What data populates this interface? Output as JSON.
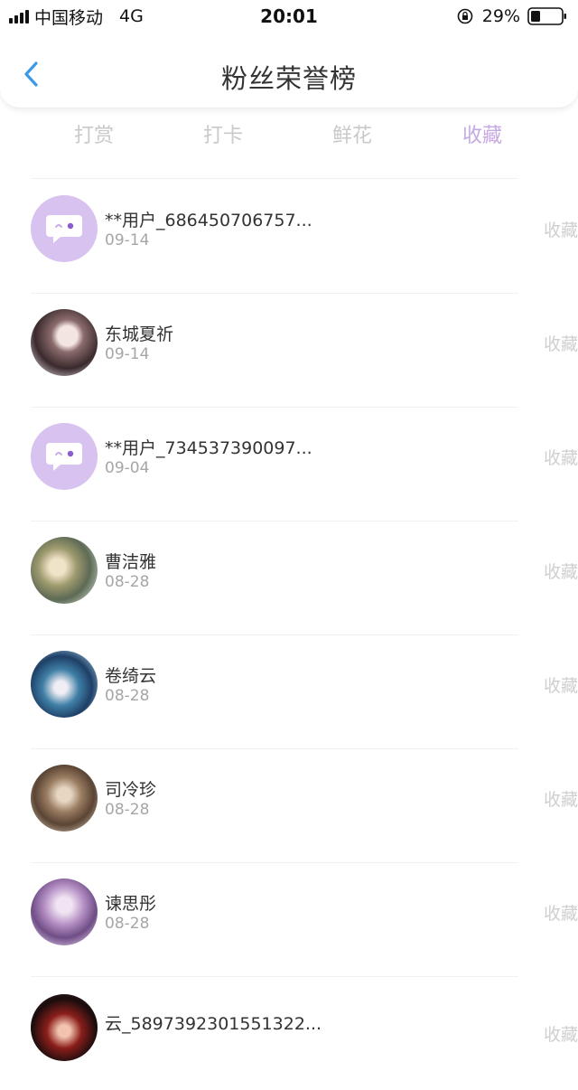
{
  "status_bar": {
    "carrier": "中国移动",
    "network": "4G",
    "time": "20:01",
    "battery": "29%"
  },
  "nav": {
    "title": "粉丝荣誉榜",
    "back_icon": "chevron-left-icon",
    "accent_color": "#3b9ae8"
  },
  "tabs": [
    {
      "label": "打赏",
      "active": false
    },
    {
      "label": "打卡",
      "active": false
    },
    {
      "label": "鲜花",
      "active": false
    },
    {
      "label": "收藏",
      "active": true
    }
  ],
  "colors": {
    "active_tab": "#c6a9e3",
    "default_avatar": "#d7c2f0",
    "muted_text": "#a6a6a6"
  },
  "fans": [
    {
      "name": "**用户_686450706757...",
      "date": "09-14",
      "action": "收藏",
      "avatar": "default-avatar-icon"
    },
    {
      "name": "东城夏祈",
      "date": "09-14",
      "action": "收藏",
      "avatar": "photo-avatar"
    },
    {
      "name": "**用户_734537390097...",
      "date": "09-04",
      "action": "收藏",
      "avatar": "default-avatar-icon"
    },
    {
      "name": "曹洁雅",
      "date": "08-28",
      "action": "收藏",
      "avatar": "photo-avatar"
    },
    {
      "name": "卷绮云",
      "date": "08-28",
      "action": "收藏",
      "avatar": "photo-avatar"
    },
    {
      "name": "司冷珍",
      "date": "08-28",
      "action": "收藏",
      "avatar": "photo-avatar"
    },
    {
      "name": "谏思彤",
      "date": "08-28",
      "action": "收藏",
      "avatar": "photo-avatar"
    },
    {
      "name": "云_5897392301551322...",
      "date": "",
      "action": "收藏",
      "avatar": "photo-avatar"
    }
  ]
}
